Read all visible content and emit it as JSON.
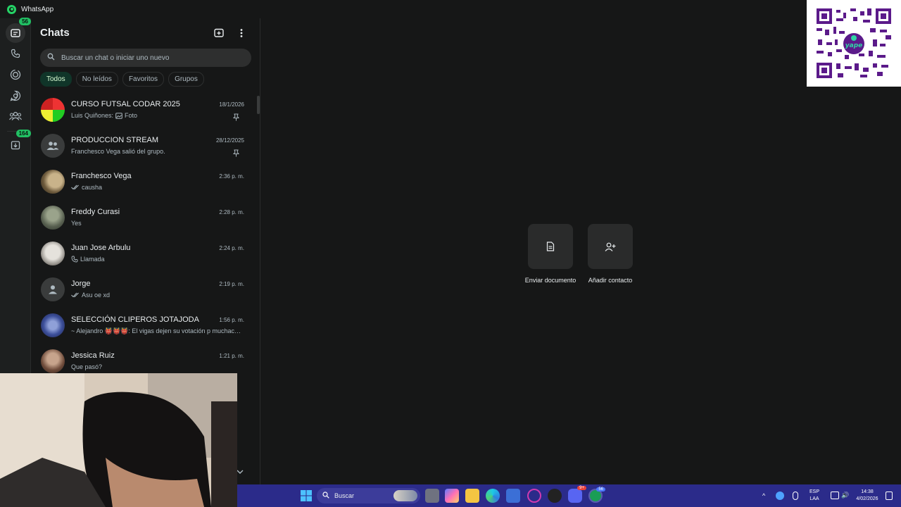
{
  "window": {
    "title": "WhatsApp"
  },
  "rail": {
    "items": [
      {
        "name": "chats",
        "badge": "56"
      },
      {
        "name": "calls"
      },
      {
        "name": "status"
      },
      {
        "name": "channels"
      },
      {
        "name": "communities"
      },
      {
        "name": "archived",
        "badge": "164"
      }
    ]
  },
  "header": {
    "title": "Chats"
  },
  "search": {
    "placeholder": "Buscar un chat o iniciar uno nuevo"
  },
  "filters": [
    "Todos",
    "No leídos",
    "Favoritos",
    "Grupos"
  ],
  "chats": [
    {
      "name": "CURSO FUTSAL CODAR 2025",
      "time": "18/1/2026",
      "sender": "Luis Quiñones:",
      "message": "Foto",
      "pinned": true,
      "icon": "image-icon"
    },
    {
      "name": "PRODUCCION STREAM",
      "time": "28/12/2025",
      "message": "Franchesco Vega salió del grupo.",
      "pinned": true
    },
    {
      "name": "Franchesco Vega",
      "time": "2:36 p. m.",
      "message": "causha",
      "icon": "double-check-icon"
    },
    {
      "name": "Freddy Curasi",
      "time": "2:28 p. m.",
      "message": "Yes"
    },
    {
      "name": "Juan Jose Arbulu",
      "time": "2:24 p. m.",
      "message": "Llamada",
      "icon": "phone-icon"
    },
    {
      "name": "Jorge",
      "time": "2:19 p. m.",
      "message": "Asu oe xd",
      "icon": "double-check-icon"
    },
    {
      "name": "SELECCIÓN CLIPEROS JOTAJODA",
      "time": "1:56 p. m.",
      "message": "~ Alejandro 👹👹👹: El vigas dejen su votación p muchachos"
    },
    {
      "name": "Jessica Ruiz",
      "time": "1:21 p. m.",
      "message": "Que pasó?"
    }
  ],
  "actions": [
    {
      "label": "Enviar documento",
      "icon": "document-icon"
    },
    {
      "label": "Añadir contacto",
      "icon": "add-contact-icon"
    }
  ],
  "qr_overlay": {
    "brand": "yape"
  },
  "taskbar": {
    "search_label": "Buscar",
    "lang": "ESP",
    "region": "LAA",
    "time": "14:38",
    "date": "4/02/2026",
    "discord_badge": "9+",
    "whatsapp_badge": "56"
  },
  "colors": {
    "accent": "#21c063",
    "background": "#161717",
    "taskbar": "#2b2b8a"
  }
}
